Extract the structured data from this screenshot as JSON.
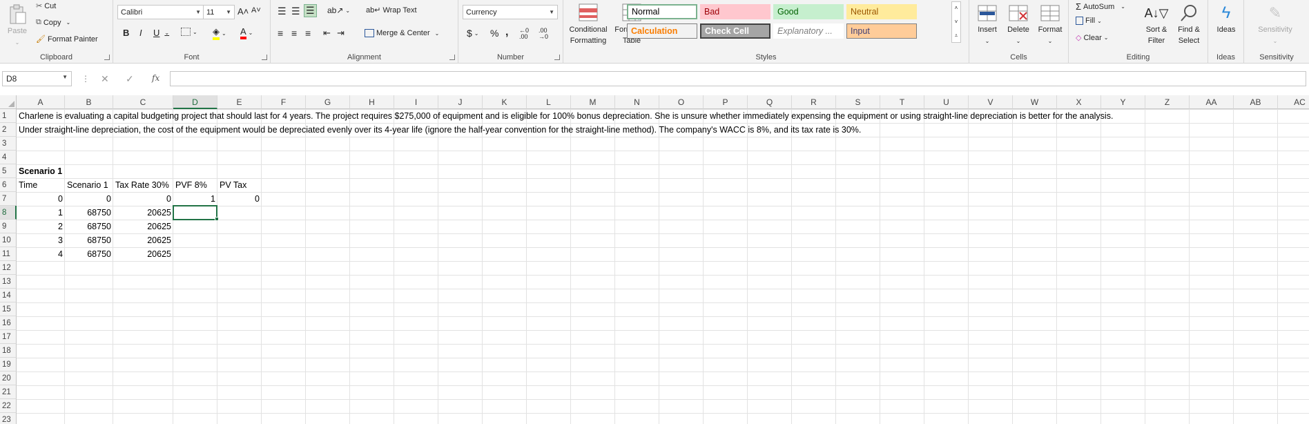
{
  "ribbon": {
    "clipboard": {
      "paste": "Paste",
      "cut": "Cut",
      "copy": "Copy",
      "format_painter": "Format Painter",
      "label": "Clipboard"
    },
    "font": {
      "name": "Calibri",
      "size": "11",
      "bold": "B",
      "italic": "I",
      "underline": "U",
      "label": "Font"
    },
    "alignment": {
      "wrap": "Wrap Text",
      "merge": "Merge & Center",
      "label": "Alignment"
    },
    "number": {
      "format": "Currency",
      "dollar": "$",
      "percent": "%",
      "comma": ",",
      "label": "Number"
    },
    "styles": {
      "conditional": "Conditional",
      "conditional2": "Formatting",
      "format_table": "Format as",
      "format_table2": "Table",
      "cells": [
        {
          "name": "Normal",
          "bg": "#ffffff",
          "color": "#000000",
          "border": "#7bb28f"
        },
        {
          "name": "Bad",
          "bg": "#ffc7ce",
          "color": "#9c0006",
          "border": "#ffc7ce"
        },
        {
          "name": "Good",
          "bg": "#c6efce",
          "color": "#006100",
          "border": "#c6efce"
        },
        {
          "name": "Neutral",
          "bg": "#ffeb9c",
          "color": "#9c5700",
          "border": "#ffeb9c"
        },
        {
          "name": "Calculation",
          "bg": "#f2f2f2",
          "color": "#fa7d00",
          "border": "#7f7f7f"
        },
        {
          "name": "Check Cell",
          "bg": "#a5a5a5",
          "color": "#ffffff",
          "border": "#3f3f3f"
        },
        {
          "name": "Explanatory ...",
          "bg": "#ffffff",
          "color": "#7f7f7f",
          "border": "#ffffff"
        },
        {
          "name": "Input",
          "bg": "#ffcc99",
          "color": "#3f3f76",
          "border": "#7f7f7f"
        }
      ],
      "label": "Styles"
    },
    "cells": {
      "insert": "Insert",
      "delete": "Delete",
      "format": "Format",
      "label": "Cells"
    },
    "editing": {
      "autosum": "AutoSum",
      "fill": "Fill",
      "clear": "Clear",
      "sort": "Sort &",
      "sort2": "Filter",
      "find": "Find &",
      "find2": "Select",
      "label": "Editing"
    },
    "ideas": {
      "btn": "Ideas",
      "label": "Ideas"
    },
    "sensitivity": {
      "btn": "Sensitivity",
      "label": "Sensitivity"
    }
  },
  "formula_bar": {
    "name_box": "D8",
    "formula": "",
    "fx": "fx"
  },
  "columns": [
    "A",
    "B",
    "C",
    "D",
    "E",
    "F",
    "G",
    "H",
    "I",
    "J",
    "K",
    "L",
    "M",
    "N",
    "O",
    "P",
    "Q",
    "R",
    "S",
    "T",
    "U",
    "V",
    "W",
    "X",
    "Y",
    "Z",
    "AA",
    "AB",
    "AC"
  ],
  "rows": [
    "1",
    "2",
    "3",
    "4",
    "5",
    "6",
    "7",
    "8",
    "9",
    "10",
    "11",
    "12",
    "13",
    "14",
    "15",
    "16",
    "17",
    "18",
    "19",
    "20",
    "21",
    "22",
    "23"
  ],
  "sheet": {
    "r1": "Charlene is evaluating a capital budgeting project that should last for 4 years. The project requires $275,000 of equipment and is eligible for 100% bonus depreciation. She is unsure whether immediately expensing the equipment or using straight-line depreciation is better for the analysis.",
    "r2": "Under straight-line depreciation, the cost of the equipment would be depreciated evenly over its 4-year life (ignore the half-year convention for the straight-line method). The company's WACC is 8%, and its tax rate is 30%.",
    "scenario": "Scenario 1",
    "headers": [
      "Time",
      "Scenario 1",
      "Tax Rate 30%",
      "PVF 8%",
      "PV Tax"
    ],
    "table": [
      [
        "0",
        "0",
        "0",
        "1",
        "0"
      ],
      [
        "1",
        "68750",
        "20625",
        "",
        ""
      ],
      [
        "2",
        "68750",
        "20625",
        "",
        ""
      ],
      [
        "3",
        "68750",
        "20625",
        "",
        ""
      ],
      [
        "4",
        "68750",
        "20625",
        "",
        ""
      ]
    ]
  }
}
